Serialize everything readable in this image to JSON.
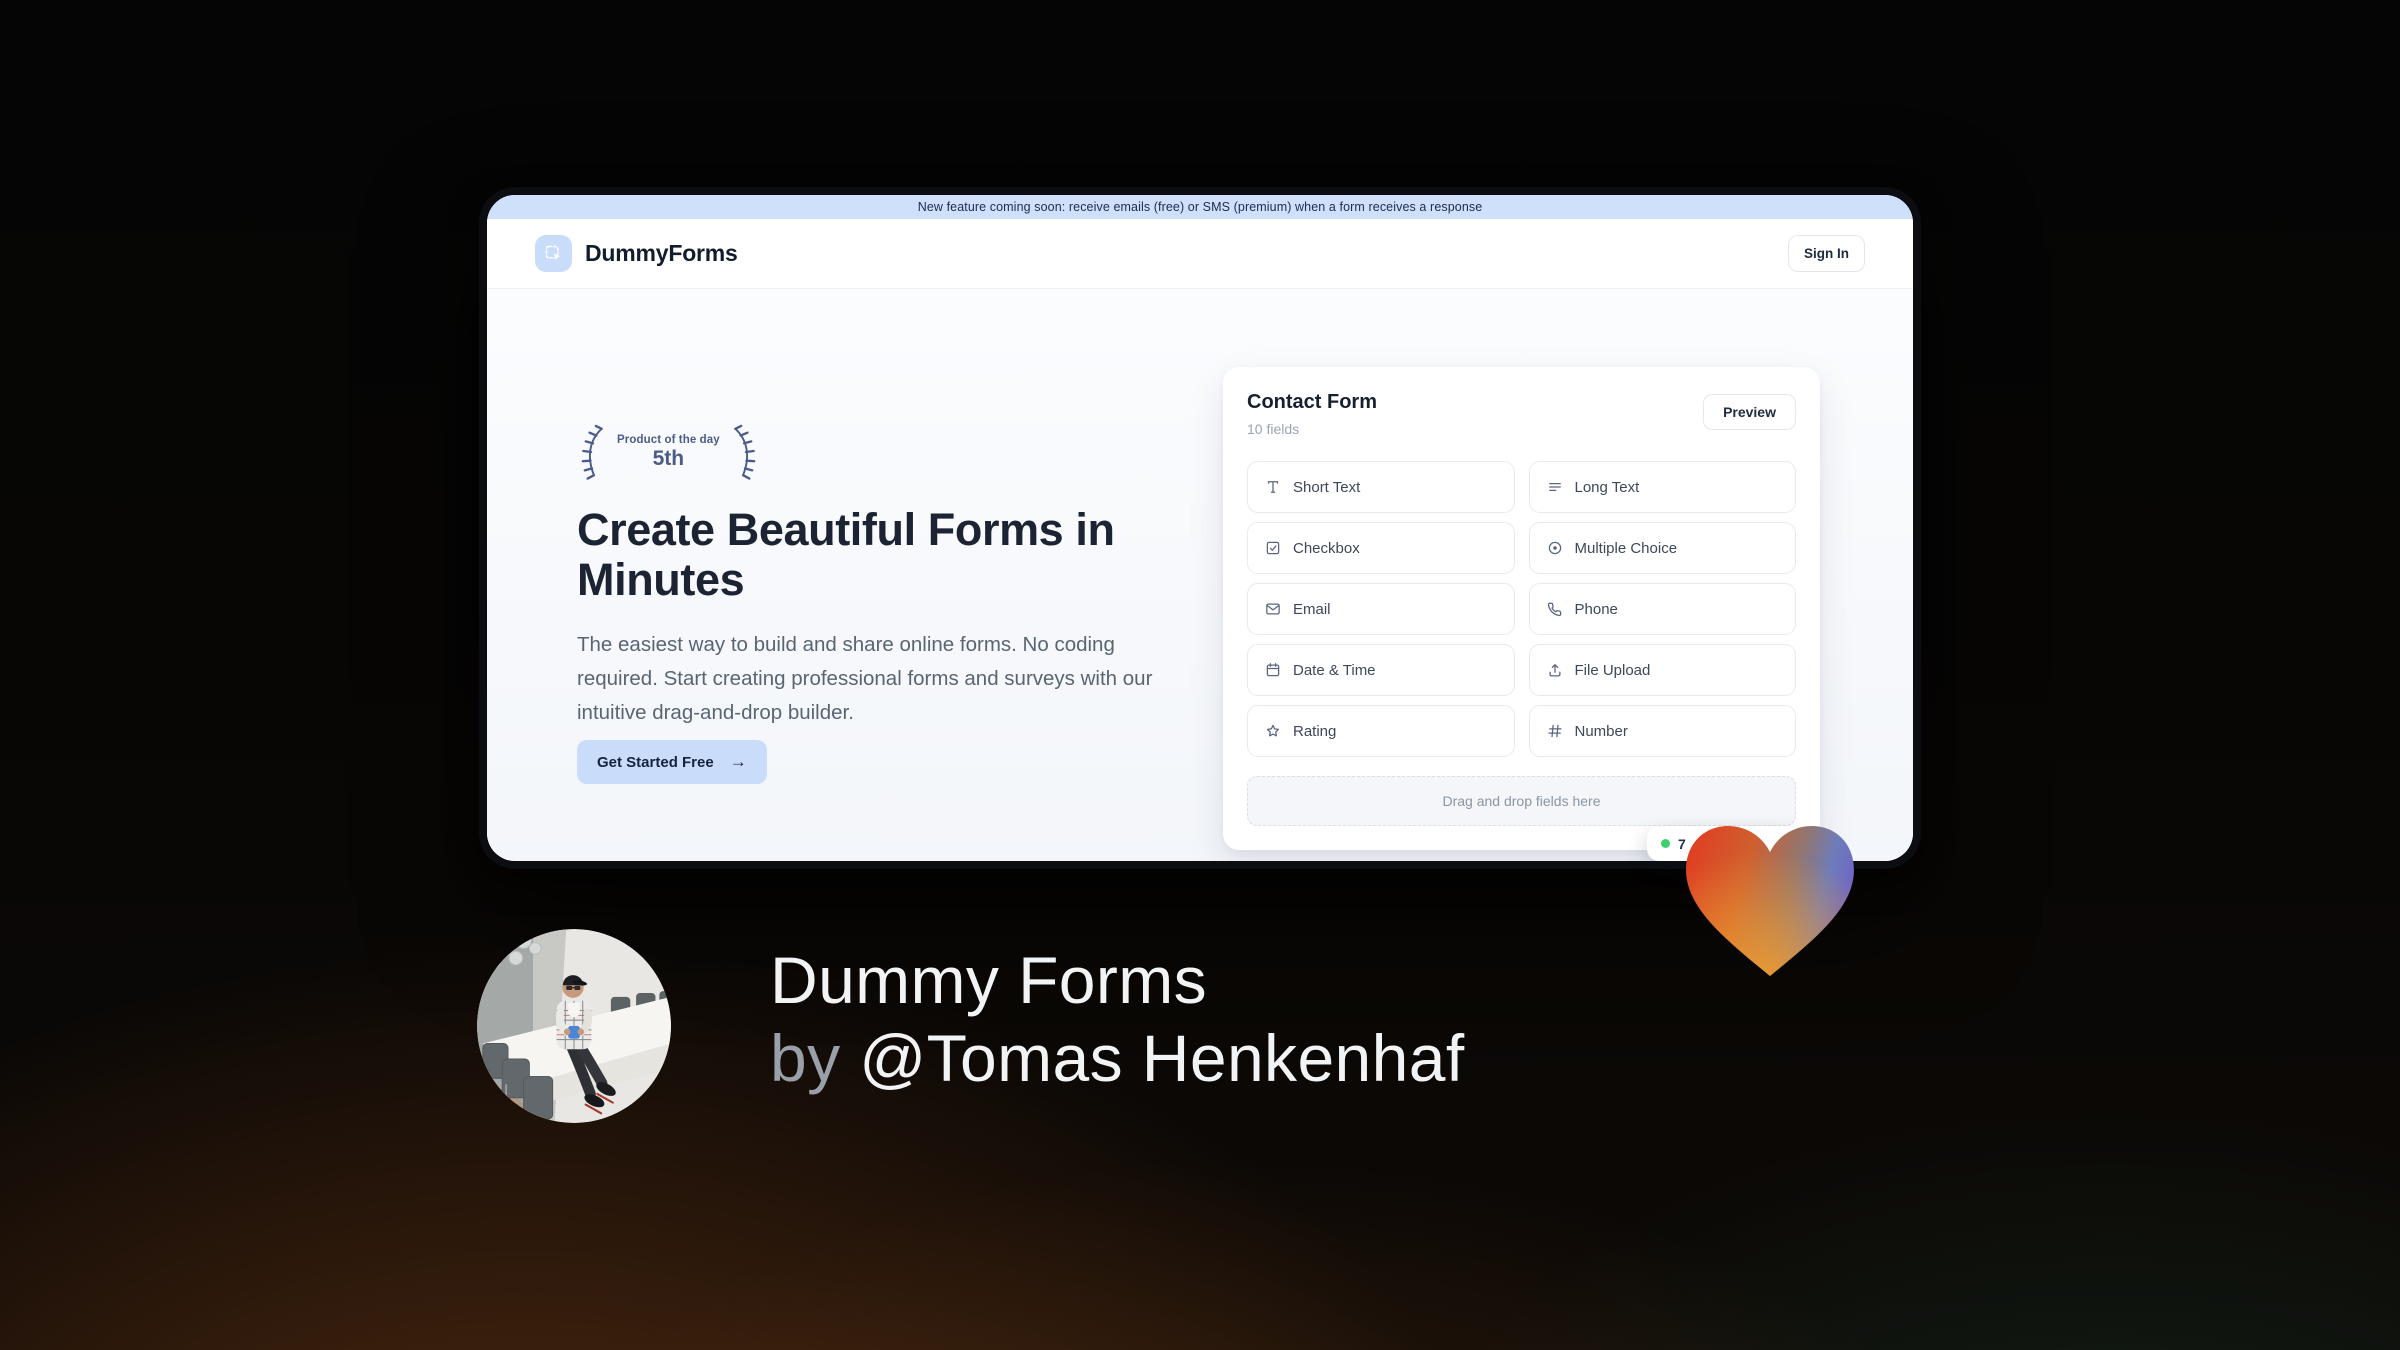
{
  "banner": {
    "text": "New feature coming soon: receive emails (free) or SMS (premium) when a form receives a response"
  },
  "header": {
    "brand": "DummyForms",
    "sign_in_label": "Sign In"
  },
  "hero": {
    "award_title": "Product of the day",
    "award_rank": "5th",
    "title": "Create Beautiful Forms in Minutes",
    "description": "The easiest way to build and share online forms. No coding required. Start creating professional forms and surveys with our intuitive drag-and-drop builder.",
    "cta_label": "Get Started Free",
    "cta_arrow": "→"
  },
  "form_card": {
    "title": "Contact Form",
    "subtitle": "10 fields",
    "preview_label": "Preview",
    "fields": [
      {
        "label": "Short Text",
        "icon": "short-text-icon"
      },
      {
        "label": "Long Text",
        "icon": "long-text-icon"
      },
      {
        "label": "Checkbox",
        "icon": "checkbox-icon"
      },
      {
        "label": "Multiple Choice",
        "icon": "multiple-choice-icon"
      },
      {
        "label": "Email",
        "icon": "email-icon"
      },
      {
        "label": "Phone",
        "icon": "phone-icon"
      },
      {
        "label": "Date & Time",
        "icon": "calendar-icon"
      },
      {
        "label": "File Upload",
        "icon": "upload-icon"
      },
      {
        "label": "Rating",
        "icon": "star-icon"
      },
      {
        "label": "Number",
        "icon": "hash-icon"
      }
    ],
    "dropzone_text": "Drag and drop fields here",
    "status_badge": {
      "visible_text": "7"
    }
  },
  "footer": {
    "line1": "Dummy Forms",
    "by_prefix": "by ",
    "author": "@Tomas Henkenhaf"
  },
  "colors": {
    "banner_bg": "#cfe0fb",
    "accent_blue": "#c9dcf9",
    "status_green": "#3ecf6e",
    "heart_red": "#e23c21",
    "heart_mid": "#cf5f2f",
    "heart_blue": "#6e7cba",
    "heart_purple": "#6f66c5",
    "heart_orange": "#f09b2e"
  }
}
